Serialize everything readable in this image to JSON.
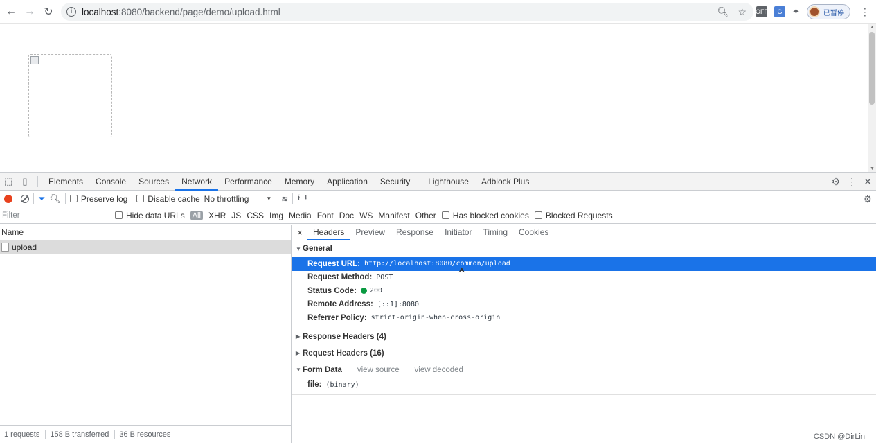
{
  "browser": {
    "url_host": "localhost",
    "url_path": ":8080/backend/page/demo/upload.html",
    "profile_label": "已暂停",
    "ext_labels": [
      "OFF"
    ]
  },
  "devtools": {
    "tabs": [
      "Elements",
      "Console",
      "Sources",
      "Network",
      "Performance",
      "Memory",
      "Application",
      "Security",
      "Lighthouse",
      "Adblock Plus"
    ],
    "active_tab": "Network",
    "toolbar": {
      "preserve_log": "Preserve log",
      "disable_cache": "Disable cache",
      "throttling": "No throttling"
    },
    "filter": {
      "placeholder": "Filter",
      "hide_data_urls": "Hide data URLs",
      "all": "All",
      "types": [
        "XHR",
        "JS",
        "CSS",
        "Img",
        "Media",
        "Font",
        "Doc",
        "WS",
        "Manifest",
        "Other"
      ],
      "has_blocked_cookies": "Has blocked cookies",
      "blocked_requests": "Blocked Requests"
    },
    "requests": {
      "column_name": "Name",
      "rows": [
        {
          "name": "upload"
        }
      ],
      "status": [
        "1 requests",
        "158 B transferred",
        "36 B resources"
      ]
    },
    "details": {
      "close": "×",
      "tabs": [
        "Headers",
        "Preview",
        "Response",
        "Initiator",
        "Timing",
        "Cookies"
      ],
      "active_tab": "Headers",
      "general_title": "General",
      "general": [
        {
          "key": "Request URL:",
          "value": "http://localhost:8080/common/upload"
        },
        {
          "key": "Request Method:",
          "value": "POST"
        },
        {
          "key": "Status Code:",
          "value": "200"
        },
        {
          "key": "Remote Address:",
          "value": "[::1]:8080"
        },
        {
          "key": "Referrer Policy:",
          "value": "strict-origin-when-cross-origin"
        }
      ],
      "response_headers": "Response Headers (4)",
      "request_headers": "Request Headers (16)",
      "form_data_title": "Form Data",
      "view_source": "view source",
      "view_decoded": "view decoded",
      "form_data": [
        {
          "key": "file:",
          "value": "(binary)"
        }
      ]
    }
  },
  "watermark": "CSDN @DirLin",
  "colors": {
    "accent": "#1a73e8",
    "record": "#e8411d",
    "status_ok": "#0a9a41"
  }
}
